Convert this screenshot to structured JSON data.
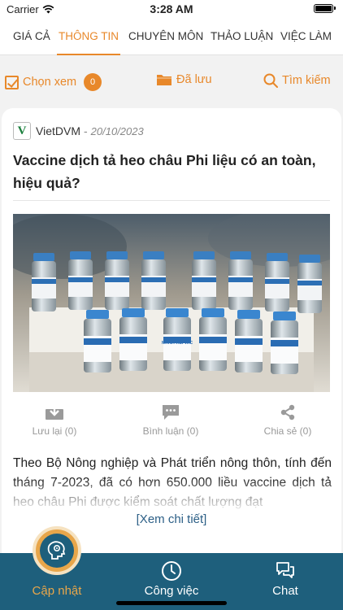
{
  "status_bar": {
    "carrier": "Carrier",
    "time": "3:28 AM"
  },
  "tabs": [
    {
      "label": "GIÁ CẢ",
      "active": false
    },
    {
      "label": "THÔNG TIN",
      "active": true
    },
    {
      "label": "CHUYÊN MÔN",
      "active": false
    },
    {
      "label": "THẢO LUẬN",
      "active": false
    },
    {
      "label": "VIỆC LÀM",
      "active": false
    }
  ],
  "actions": {
    "select_label": "Chọn xem",
    "select_count": "0",
    "saved_label": "Đã lưu",
    "search_label": "Tìm kiếm"
  },
  "post": {
    "author_logo": "V",
    "author": "VietDVM",
    "separator": "-",
    "date": "20/10/2023",
    "title": "Vaccine dịch tả heo châu Phi liệu có an toàn, hiệu quả?",
    "excerpt": "Theo Bộ Nông nghiệp và Phát triển nông thôn, tính đến tháng 7-2023, đã có hơn 650.000 liều vaccine dịch tả heo châu Phi được kiểm soát chất lượng đạt",
    "more_label": "[Xem chi tiết]",
    "vial_label": "NAVET-ASFVAC",
    "engagement": {
      "save_label": "Lưu lại (0)",
      "comment_label": "Bình luận (0)",
      "share_label": "Chia sẻ (0)"
    }
  },
  "bottom_nav": [
    {
      "label": "Cập nhật",
      "icon": "brain-gear-icon",
      "active": true
    },
    {
      "label": "Công việc",
      "icon": "clock-icon",
      "active": false
    },
    {
      "label": "Chat",
      "icon": "chat-bubbles-icon",
      "active": false
    }
  ],
  "colors": {
    "accent": "#e8882a",
    "nav_background": "#1e5f7c",
    "link": "#2c5f86",
    "brand_green": "#1a7f3c"
  }
}
